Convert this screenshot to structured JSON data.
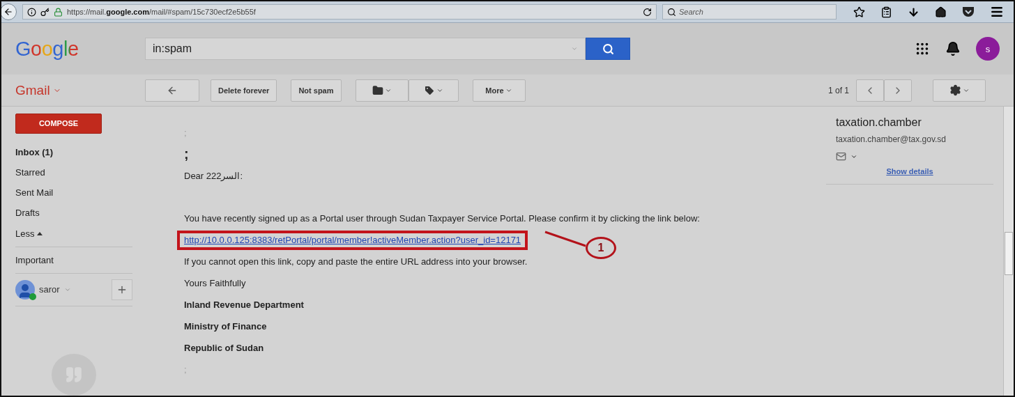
{
  "browser": {
    "url": "https://mail.**google.com**/mail/#spam/15c730ecf2e5b55f",
    "search": {
      "placeholder": "Search"
    }
  },
  "header": {
    "logo": "Google",
    "search": {
      "value": "in:spam"
    },
    "avatar": "s"
  },
  "toolbar": {
    "app_menu": "Gmail",
    "buttons": [
      {
        "kind": "back"
      },
      {
        "kind": "text",
        "label": "Delete forever"
      },
      {
        "kind": "text",
        "label": "Not spam"
      },
      {
        "kind": "folder"
      },
      {
        "kind": "tag"
      },
      {
        "kind": "menu",
        "label": "More"
      }
    ],
    "pager": "1 of 1"
  },
  "sidebar": {
    "compose": "COMPOSE",
    "items": [
      {
        "label": "Inbox (1)",
        "unread": true,
        "kind": "folder"
      },
      {
        "label": "Starred",
        "unread": false,
        "kind": "folder"
      },
      {
        "label": "Sent Mail",
        "unread": false,
        "kind": "folder"
      },
      {
        "label": "Drafts",
        "unread": false,
        "kind": "folder"
      },
      {
        "label": "Less",
        "unread": false,
        "kind": "toggle"
      },
      {
        "label": "Important",
        "unread": false,
        "kind": "folder"
      }
    ],
    "account": {
      "name": "saror",
      "online": true
    }
  },
  "message": {
    "lines": [
      {
        "kind": "faint",
        "text": ";"
      },
      {
        "kind": "big",
        "text": ";"
      },
      {
        "kind": "line",
        "text": "Dear 222السر:"
      },
      {
        "kind": "paragraph",
        "text": "You have recently signed up as a Portal user through Sudan Taxpayer Service Portal. Please confirm it by clicking the link below:"
      },
      {
        "kind": "link",
        "text": "http://10.0.0.125:8383/retPortal/portal/member!activeMember.action?user_id=12171"
      },
      {
        "kind": "line",
        "text": "If you cannot open this link, copy and paste the entire URL address into your browser."
      },
      {
        "kind": "line",
        "text": "Yours Faithfully"
      },
      {
        "kind": "bold",
        "text": "Inland Revenue Department"
      },
      {
        "kind": "bold",
        "text": "Ministry of Finance"
      },
      {
        "kind": "bold",
        "text": "Republic of Sudan"
      },
      {
        "kind": "faint",
        "text": ";"
      }
    ],
    "annotation": {
      "label": "1"
    }
  },
  "sender": {
    "name": "taxation.chamber",
    "email": "taxation.chamber@tax.gov.sd",
    "details_link": "Show details"
  }
}
